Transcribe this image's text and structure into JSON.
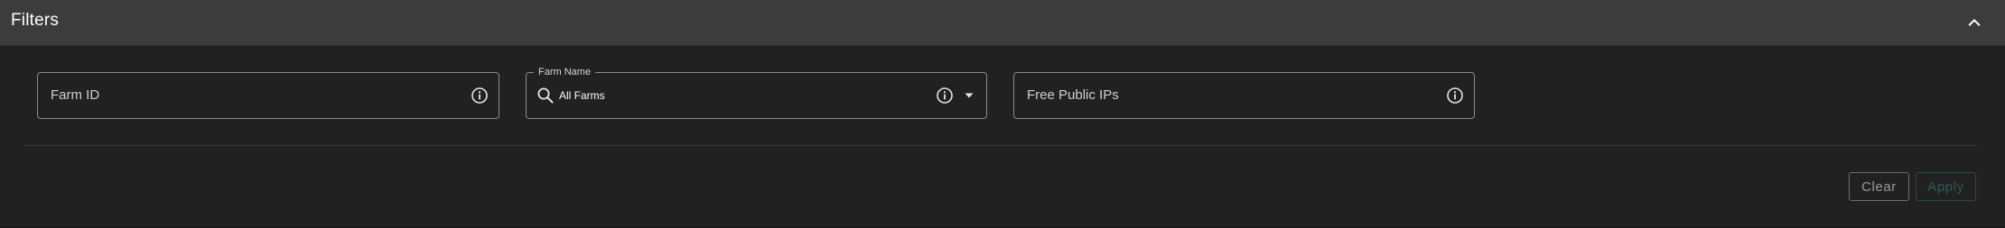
{
  "header": {
    "title": "Filters",
    "collapse_icon": "chevron-up-icon"
  },
  "filters": {
    "farm_id": {
      "placeholder": "Farm ID",
      "value": "",
      "icon": "info-icon"
    },
    "farm_name": {
      "label": "Farm Name",
      "value": "All Farms",
      "search_icon": "search-icon",
      "info_icon": "info-icon",
      "dropdown_icon": "caret-down-icon"
    },
    "free_public_ips": {
      "placeholder": "Free Public IPs",
      "value": "",
      "icon": "info-icon"
    }
  },
  "actions": {
    "clear_label": "Clear",
    "apply_label": "Apply"
  },
  "colors": {
    "header_bg": "#3c3c3c",
    "panel_bg": "#212121",
    "apply_disabled": "#2f5a50"
  }
}
